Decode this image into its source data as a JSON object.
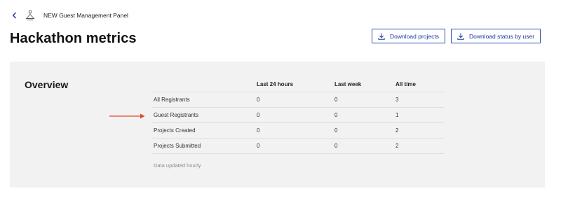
{
  "header": {
    "app_name": "NEW Guest Management Panel"
  },
  "page": {
    "title": "Hackathon metrics"
  },
  "actions": {
    "download_projects": "Download projects",
    "download_status": "Download status by user"
  },
  "overview": {
    "title": "Overview",
    "columns": [
      "",
      "Last 24 hours",
      "Last week",
      "All time"
    ],
    "rows": [
      {
        "label": "All Registrants",
        "last_24h": "0",
        "last_week": "0",
        "all_time": "3"
      },
      {
        "label": "Guest Registrants",
        "last_24h": "0",
        "last_week": "0",
        "all_time": "1"
      },
      {
        "label": "Projects Created",
        "last_24h": "0",
        "last_week": "0",
        "all_time": "2"
      },
      {
        "label": "Projects Submitted",
        "last_24h": "0",
        "last_week": "0",
        "all_time": "2"
      }
    ],
    "footnote": "Data updated hourly"
  },
  "annotation": {
    "arrow_color": "#e8462b"
  }
}
